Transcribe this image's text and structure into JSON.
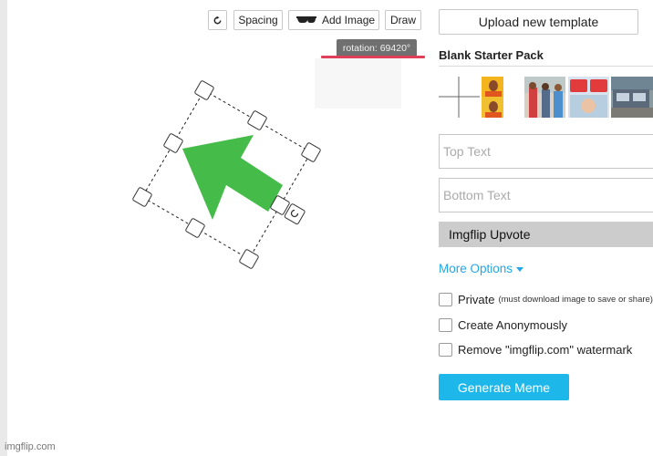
{
  "toolbar": {
    "spacing_label": "Spacing",
    "add_image_label": "Add Image",
    "draw_label": "Draw"
  },
  "canvas": {
    "tooltip_text": "rotation: 69420°",
    "watermark": "imgflip.com",
    "arrow_color": "#45bc4a"
  },
  "panel": {
    "upload_label": "Upload new template",
    "pack_title": "Blank Starter Pack",
    "top_text_placeholder": "Top Text",
    "bottom_text_placeholder": "Bottom Text",
    "template_name": "Imgflip Upvote",
    "more_options_label": "More Options",
    "options": [
      {
        "label": "Private",
        "note": "(must download image to save or share)"
      },
      {
        "label": "Create Anonymously",
        "note": ""
      },
      {
        "label": "Remove \"imgflip.com\" watermark",
        "note": ""
      }
    ],
    "generate_label": "Generate Meme"
  },
  "colors": {
    "accent_blue": "#1eb7ea",
    "link_blue": "#22a6e8",
    "tooltip_underline": "#e0405a"
  }
}
